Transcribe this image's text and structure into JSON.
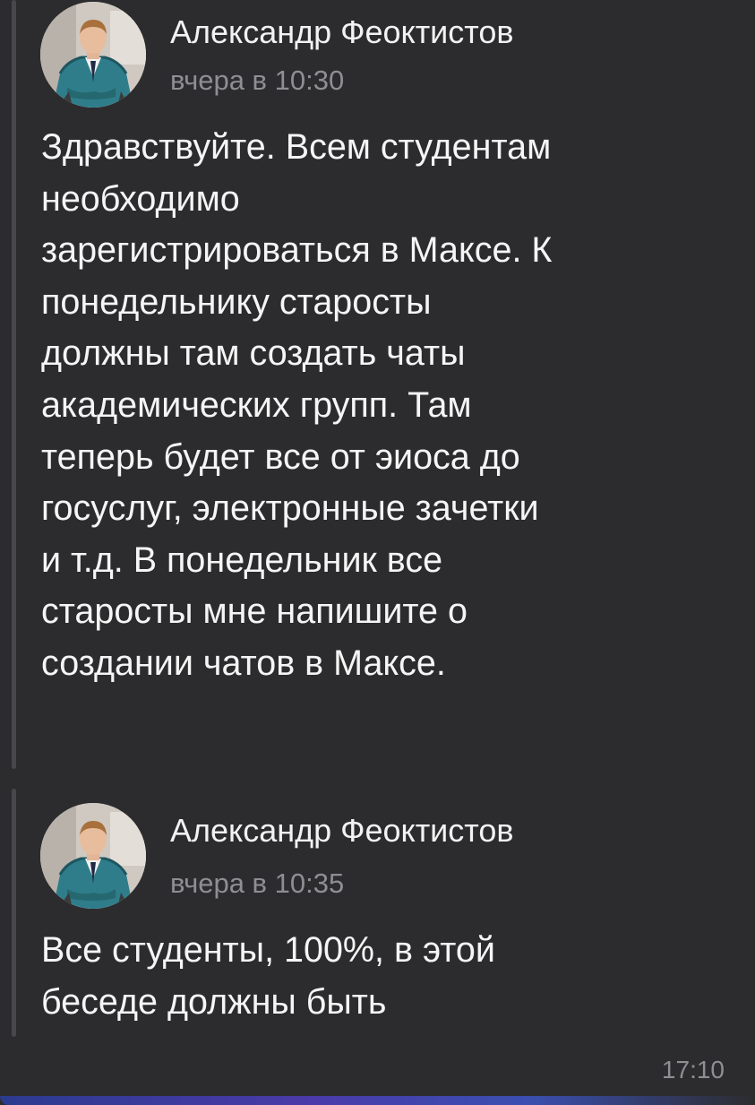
{
  "posts": [
    {
      "author": "Александр Феоктистов",
      "time": "вчера в 10:30",
      "text": "Здравствуйте. Всем студентам\nнеобходимо\nзарегистрироваться в Максе. К\nпонедельнику старосты\nдолжны там создать чаты\nакадемических групп. Там\nтеперь будет все от эиоса до\nгосуслуг,  электронные зачетки\nи т.д. В понедельник все\nстаросты мне напишите о\nсоздании чатов в Максе.",
      "avatar_icon": "person-photo-avatar"
    },
    {
      "author": "Александр Феоктистов",
      "time": "вчера в 10:35",
      "text": "Все студенты, 100%, в этой\nбеседе должны быть",
      "avatar_icon": "person-photo-avatar"
    }
  ],
  "message_time": "17:10",
  "colors": {
    "background": "#2c2c2e",
    "quote_bar": "#48484c",
    "secondary_text": "#8e8e93",
    "primary_text": "#f5f5f5"
  }
}
